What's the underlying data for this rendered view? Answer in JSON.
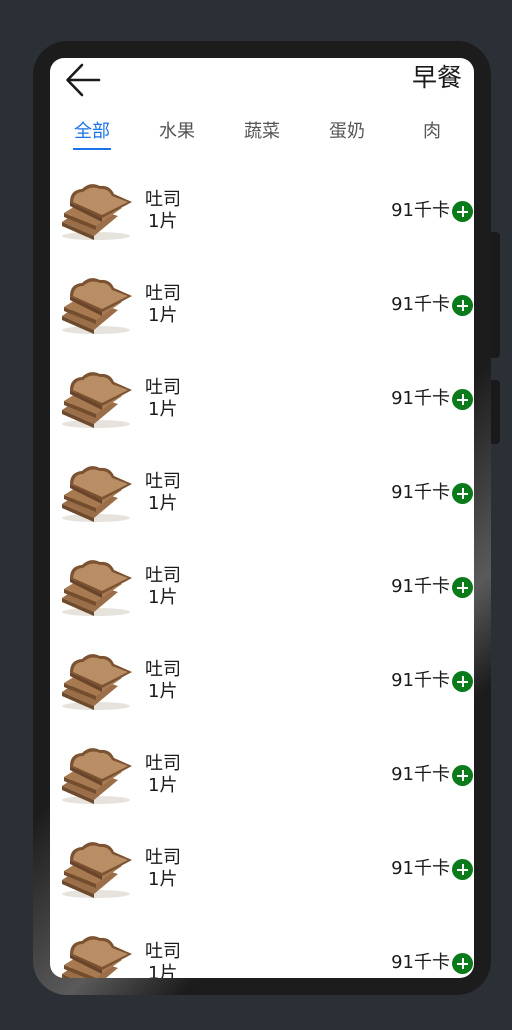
{
  "header": {
    "back_icon": "arrow-left-icon",
    "title": "早餐"
  },
  "tabs": [
    {
      "label": "全部",
      "active": true
    },
    {
      "label": "水果",
      "active": false
    },
    {
      "label": "蔬菜",
      "active": false
    },
    {
      "label": "蛋奶",
      "active": false
    },
    {
      "label": "肉",
      "active": false
    }
  ],
  "colors": {
    "accent": "#1a73e8",
    "add_button": "#0a7a1a"
  },
  "foods": [
    {
      "name": "吐司",
      "quantity": "1片",
      "calories": "91千卡",
      "image": "toast-image",
      "action_icon": "plus-circle-icon"
    },
    {
      "name": "吐司",
      "quantity": "1片",
      "calories": "91千卡",
      "image": "toast-image",
      "action_icon": "plus-circle-icon"
    },
    {
      "name": "吐司",
      "quantity": "1片",
      "calories": "91千卡",
      "image": "toast-image",
      "action_icon": "plus-circle-icon"
    },
    {
      "name": "吐司",
      "quantity": "1片",
      "calories": "91千卡",
      "image": "toast-image",
      "action_icon": "plus-circle-icon"
    },
    {
      "name": "吐司",
      "quantity": "1片",
      "calories": "91千卡",
      "image": "toast-image",
      "action_icon": "plus-circle-icon"
    },
    {
      "name": "吐司",
      "quantity": "1片",
      "calories": "91千卡",
      "image": "toast-image",
      "action_icon": "plus-circle-icon"
    },
    {
      "name": "吐司",
      "quantity": "1片",
      "calories": "91千卡",
      "image": "toast-image",
      "action_icon": "plus-circle-icon"
    },
    {
      "name": "吐司",
      "quantity": "1片",
      "calories": "91千卡",
      "image": "toast-image",
      "action_icon": "plus-circle-icon"
    },
    {
      "name": "吐司",
      "quantity": "1片",
      "calories": "91千卡",
      "image": "toast-image",
      "action_icon": "plus-circle-icon"
    }
  ]
}
